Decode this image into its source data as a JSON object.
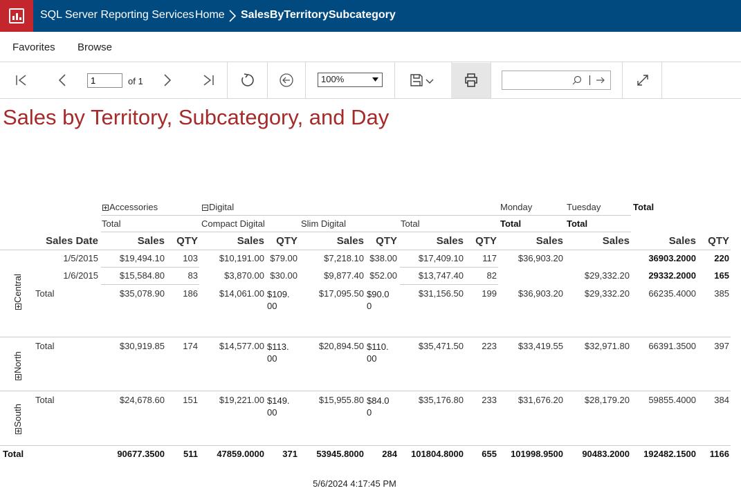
{
  "header": {
    "app_title": "SQL Server Reporting Services",
    "home": "Home",
    "report_name": "SalesByTerritorySubcategory"
  },
  "menu": {
    "favorites": "Favorites",
    "browse": "Browse"
  },
  "toolbar": {
    "page_value": "1",
    "of_label": "of 1",
    "zoom": "100%",
    "search_placeholder": ""
  },
  "report": {
    "title": "Sales by Territory, Subcategory, and Day",
    "col_groups": {
      "accessories": "Accessories",
      "digital": "Digital",
      "monday": "Monday",
      "tuesday": "Tuesday",
      "total": "Total"
    },
    "subgroups": {
      "acc_total": "Total",
      "compact_digital": "Compact Digital",
      "slim_digital": "Slim Digital",
      "digital_total": "Total",
      "monday_total": "Total",
      "tuesday_total": "Total"
    },
    "headers": {
      "sales_date": "Sales Date",
      "sales": "Sales",
      "qty": "QTY"
    },
    "territories": {
      "central": "Central",
      "north": "North",
      "south": "South"
    },
    "rows": [
      [
        "1/5/2015",
        "$19,494.10",
        "103",
        "$10,191.00",
        "$79.00",
        "$7,218.10",
        "$38.00",
        "$17,409.10",
        "117",
        "$36,903.20",
        "",
        "36903.2000",
        "220"
      ],
      [
        "1/6/2015",
        "$15,584.80",
        "83",
        "$3,870.00",
        "$30.00",
        "$9,877.40",
        "$52.00",
        "$13,747.40",
        "82",
        "",
        "$29,332.20",
        "29332.2000",
        "165"
      ],
      [
        "Total",
        "$35,078.90",
        "186",
        "$14,061.00",
        "$109.00",
        "$17,095.50",
        "$90.00",
        "$31,156.50",
        "199",
        "$36,903.20",
        "$29,332.20",
        "66235.4000",
        "385"
      ],
      [
        "Total",
        "$30,919.85",
        "174",
        "$14,577.00",
        "$113.00",
        "$20,894.50",
        "$110.00",
        "$35,471.50",
        "223",
        "$33,419.55",
        "$32,971.80",
        "66391.3500",
        "397"
      ],
      [
        "Total",
        "$24,678.60",
        "151",
        "$19,221.00",
        "$149.00",
        "$15,955.80",
        "$84.00",
        "$35,176.80",
        "233",
        "$31,676.20",
        "$28,179.20",
        "59855.4000",
        "384"
      ]
    ],
    "grand_total": {
      "label": "Total",
      "values": [
        "90677.3500",
        "511",
        "47859.0000",
        "371",
        "53945.8000",
        "284",
        "101804.8000",
        "655",
        "101998.9500",
        "90483.2000",
        "192482.1500",
        "1166"
      ]
    },
    "timestamp": "5/6/2024 4:17:45 PM"
  },
  "colors": {
    "topbar": "#004a80",
    "logo": "#c4262e",
    "title": "#a52a2a"
  },
  "icons": [
    "report-logo-icon",
    "chevron-right-icon",
    "first-page-icon",
    "previous-page-icon",
    "next-page-icon",
    "last-page-icon",
    "refresh-icon",
    "back-icon",
    "save-icon",
    "chevron-down-icon",
    "print-icon",
    "search-icon",
    "find-next-icon",
    "fullscreen-icon",
    "expand-toggle-icon",
    "collapse-toggle-icon"
  ]
}
